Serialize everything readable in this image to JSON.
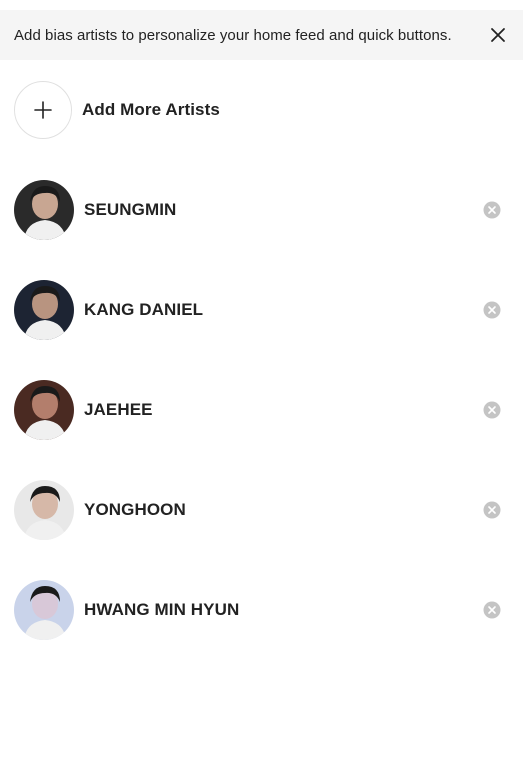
{
  "banner": {
    "text": "Add bias artists to personalize your home feed and quick buttons."
  },
  "add_artists": {
    "label": "Add More Artists"
  },
  "artists": [
    {
      "name": "SEUNGMIN",
      "tone": "#c8a692",
      "bg": "#2a2a2a"
    },
    {
      "name": "KANG DANIEL",
      "tone": "#b89480",
      "bg": "#1d2433"
    },
    {
      "name": "JAEHEE",
      "tone": "#b37e6c",
      "bg": "#4a2a22"
    },
    {
      "name": "YONGHOON",
      "tone": "#d6b8a8",
      "bg": "#e8e8e8"
    },
    {
      "name": "HWANG MIN HYUN",
      "tone": "#d8c8d8",
      "bg": "#c9d3ea"
    }
  ],
  "icons": {
    "close": "close-icon",
    "plus": "plus-icon",
    "remove": "remove-circle-icon"
  },
  "colors": {
    "banner_bg": "#f5f5f5",
    "remove_icon": "#c4c4c4"
  }
}
